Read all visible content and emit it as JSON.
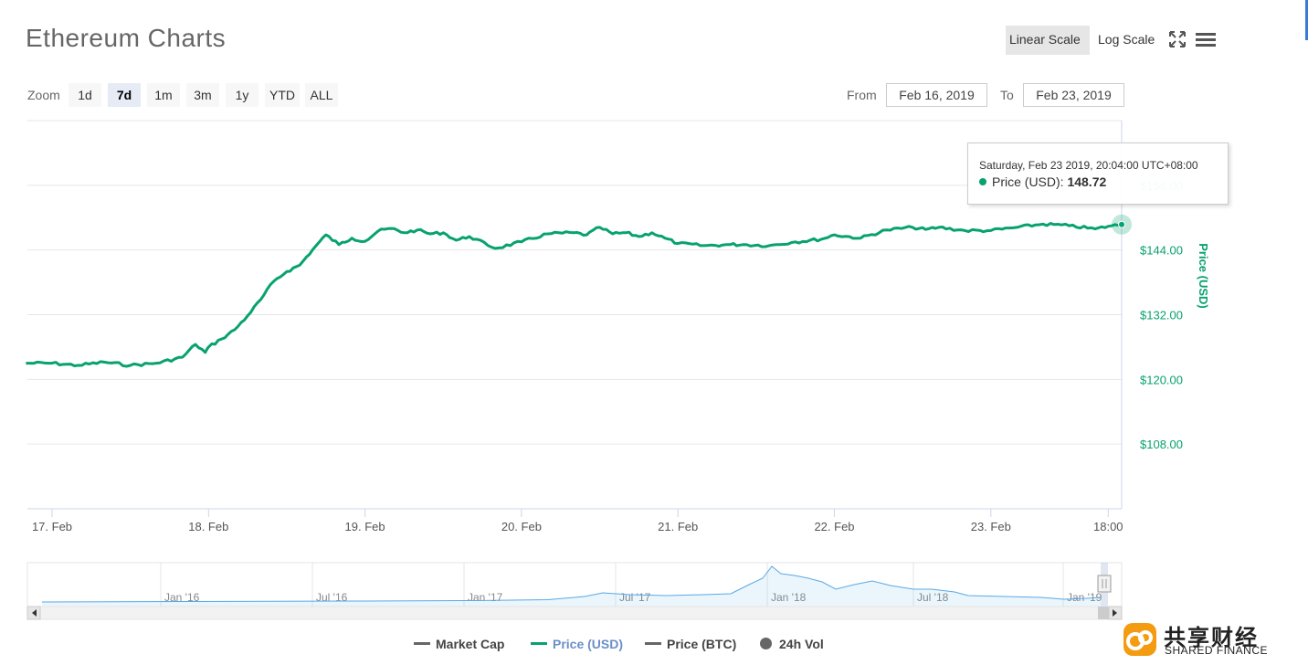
{
  "page": {
    "title": "Ethereum Charts"
  },
  "toolbar": {
    "linear_scale": "Linear Scale",
    "log_scale": "Log Scale",
    "fullscreen_icon": "fullscreen-icon",
    "menu_icon": "hamburger-menu-icon"
  },
  "zoom": {
    "label": "Zoom",
    "buttons": [
      "1d",
      "7d",
      "1m",
      "3m",
      "1y",
      "YTD",
      "ALL"
    ],
    "active": "7d"
  },
  "range": {
    "from_label": "From",
    "from_value": "Feb 16, 2019",
    "to_label": "To",
    "to_value": "Feb 23, 2019"
  },
  "tooltip": {
    "date": "Saturday, Feb 23 2019, 20:04:00 UTC+08:00",
    "series": "Price (USD)",
    "value": "148.72"
  },
  "legend": {
    "items": [
      {
        "name": "Market Cap",
        "color": "#666666"
      },
      {
        "name": "Price (USD)",
        "color": "#08a26f"
      },
      {
        "name": "Price (BTC)",
        "color": "#666666"
      },
      {
        "name": "24h Vol",
        "color": "#666666"
      }
    ]
  },
  "brand": {
    "cn": "共享财经",
    "en": "SHARED FINANCE"
  },
  "colors": {
    "price_line": "#08a26f",
    "navigator_line": "#5aa9e6",
    "grid": "#e6e6e6"
  },
  "chart_data": {
    "type": "line",
    "title": "Ethereum Charts",
    "ylabel": "Price (USD)",
    "yticks": [
      "$108.00",
      "$120.00",
      "$132.00",
      "$144.00",
      "$156.00"
    ],
    "xticks": [
      "17. Feb",
      "18. Feb",
      "19. Feb",
      "20. Feb",
      "21. Feb",
      "22. Feb",
      "23. Feb",
      "18:00"
    ],
    "ylim": [
      96,
      168
    ],
    "grid": true,
    "series": [
      {
        "name": "Price (USD)",
        "x": [
          "2019-02-16 20:00",
          "2019-02-17 00:00",
          "2019-02-17 04:00",
          "2019-02-17 08:00",
          "2019-02-17 12:00",
          "2019-02-17 16:00",
          "2019-02-17 20:00",
          "2019-02-17 22:00",
          "2019-02-17 23:30",
          "2019-02-18 00:00",
          "2019-02-18 02:00",
          "2019-02-18 04:00",
          "2019-02-18 06:00",
          "2019-02-18 08:00",
          "2019-02-18 10:00",
          "2019-02-18 12:00",
          "2019-02-18 14:00",
          "2019-02-18 16:00",
          "2019-02-18 18:00",
          "2019-02-18 20:00",
          "2019-02-18 22:00",
          "2019-02-19 00:00",
          "2019-02-19 02:00",
          "2019-02-19 04:00",
          "2019-02-19 06:00",
          "2019-02-19 08:00",
          "2019-02-19 10:00",
          "2019-02-19 12:00",
          "2019-02-19 14:00",
          "2019-02-19 16:00",
          "2019-02-19 20:00",
          "2019-02-20 00:00",
          "2019-02-20 04:00",
          "2019-02-20 08:00",
          "2019-02-20 10:00",
          "2019-02-20 12:00",
          "2019-02-20 14:00",
          "2019-02-20 16:00",
          "2019-02-20 18:00",
          "2019-02-20 20:00",
          "2019-02-20 22:00",
          "2019-02-21 00:00",
          "2019-02-21 04:00",
          "2019-02-21 08:00",
          "2019-02-21 10:00",
          "2019-02-21 14:00",
          "2019-02-21 18:00",
          "2019-02-21 22:00",
          "2019-02-22 00:00",
          "2019-02-22 04:00",
          "2019-02-22 08:00",
          "2019-02-22 12:00",
          "2019-02-22 14:00",
          "2019-02-22 16:00",
          "2019-02-22 20:00",
          "2019-02-23 00:00",
          "2019-02-23 04:00",
          "2019-02-23 08:00",
          "2019-02-23 12:00",
          "2019-02-23 16:00",
          "2019-02-23 18:00",
          "2019-02-23 20:04"
        ],
        "values": [
          123.0,
          123.0,
          122.6,
          123.2,
          122.6,
          123.0,
          124.1,
          126.5,
          125.0,
          126.0,
          127.5,
          129.2,
          131.8,
          134.8,
          138.2,
          140.0,
          141.2,
          144.1,
          146.8,
          145.0,
          146.2,
          145.6,
          147.5,
          148.0,
          147.2,
          147.7,
          147.0,
          147.2,
          145.8,
          146.5,
          144.3,
          145.5,
          147.0,
          147.2,
          146.8,
          148.2,
          147.0,
          147.2,
          146.5,
          147.2,
          146.2,
          145.2,
          144.8,
          145.0,
          145.0,
          144.8,
          145.5,
          146.0,
          146.8,
          146.2,
          147.7,
          148.2,
          147.8,
          148.2,
          147.6,
          147.6,
          148.2,
          148.8,
          148.5,
          147.9,
          148.4,
          148.72
        ]
      }
    ],
    "navigator": {
      "labels": [
        "Jan '16",
        "Jul '16",
        "Jan '17",
        "Jul '17",
        "Jan '18",
        "Jul '18",
        "Jan '19"
      ]
    }
  }
}
